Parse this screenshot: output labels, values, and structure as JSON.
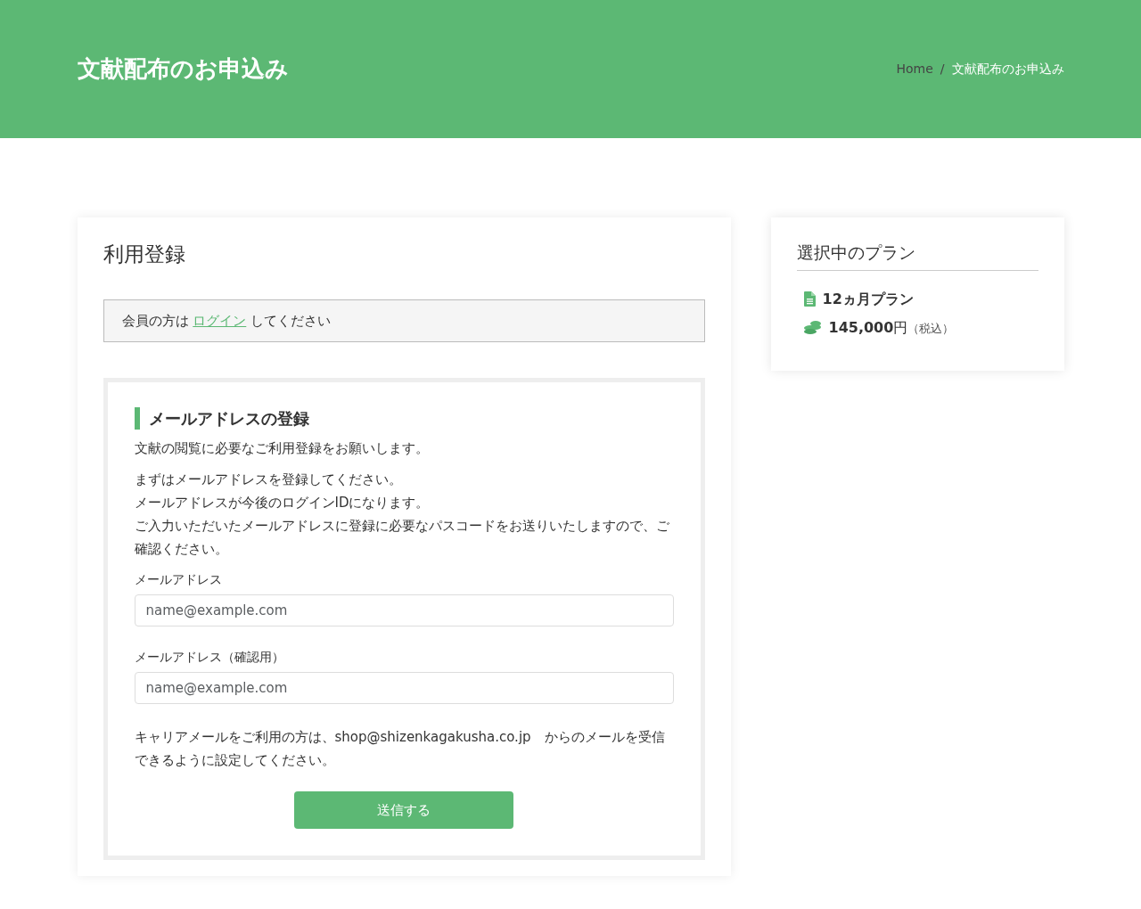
{
  "header": {
    "title": "文献配布のお申込み",
    "separator": "/",
    "breadcrumb": [
      {
        "label": "Home",
        "current": false
      },
      {
        "label": "文献配布のお申込み",
        "current": true
      }
    ]
  },
  "main": {
    "title": "利用登録",
    "notice": {
      "before": "会員の方は",
      "link": "ログイン",
      "after": "してください"
    },
    "form": {
      "heading": "メールアドレスの登録",
      "intro": "文献の閲覧に必要なご利用登録をお願いします。",
      "lines": [
        "まずはメールアドレスを登録してください。",
        "メールアドレスが今後のログインIDになります。",
        "ご入力いただいたメールアドレスに登録に必要なパスコードをお送りいたしますので、ご確認ください。"
      ],
      "fields": [
        {
          "label": "メールアドレス",
          "placeholder": "name@example.com"
        },
        {
          "label": "メールアドレス（確認用）",
          "placeholder": "name@example.com"
        }
      ],
      "note": "キャリアメールをご利用の方は、shop@shizenkagakusha.co.jp　からのメールを受信できるように設定してください。",
      "submit": "送信する"
    }
  },
  "sidebar": {
    "title": "選択中のプラン",
    "plan": "12ヵ月プラン",
    "price": "145,000",
    "unit": "円",
    "tax": "（税込）"
  }
}
